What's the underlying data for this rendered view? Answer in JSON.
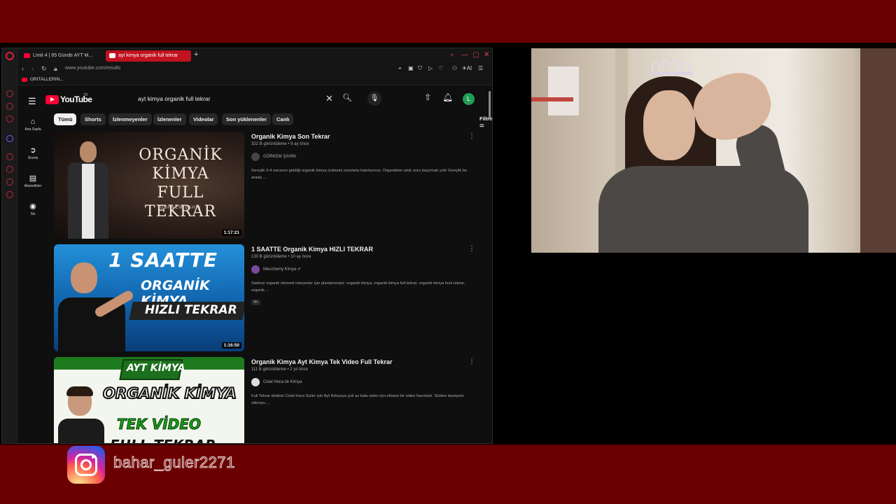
{
  "browser": {
    "tabs": [
      {
        "label": "Limit 4 | 65 Günde AYT M...",
        "active": false
      },
      {
        "label": "ayt kimya organik full tekrar",
        "active": true
      }
    ],
    "url": "www.youtube.com/results",
    "bookmark": "ORITALLERIN...",
    "ai_label": "AI"
  },
  "youtube": {
    "logo_text": "YouTube",
    "logo_country": "TR",
    "search_query": "ayt kimya organik full tekrar",
    "avatar_letter": "L",
    "guide": [
      {
        "label": "Ana Sayfa",
        "icon": "home-icon"
      },
      {
        "label": "Shorts",
        "icon": "shorts-icon"
      },
      {
        "label": "Abonelikler",
        "icon": "subscriptions-icon"
      },
      {
        "label": "Siz",
        "icon": "you-icon"
      }
    ],
    "chips": [
      "Tümü",
      "Shorts",
      "İzlenmeyenler",
      "İzlenenler",
      "Videolar",
      "Son yüklenenler",
      "Canlı"
    ],
    "filters_label": "Filtreler",
    "results": [
      {
        "title": "Organik Kimya Son Tekrar",
        "stats": "322 B görüntüleme • 9 ay önce",
        "channel": "GÖRKEM ŞAHİN",
        "description": "Gençlik 3-4 sorunun geldiği organik kimya ünitesini sorularla hatırlıyoruz. Organikten artık soru kaçırmak yok! Gençlik bu arada ...",
        "duration": "1:17:21",
        "thumb_text": [
          "ORGANİK",
          "KİMYA",
          "FULL TEKRAR"
        ],
        "thumb_sub": "GÖRKEM ŞAHİN"
      },
      {
        "title": "1 SAATTE Organik Kimya HIZLI TEKRAR",
        "stats": "130 B görüntüleme • 10 ay önce",
        "channel": "Meschemy Kimya",
        "description": "Sadece organik izlemek isteyenler için planlanmıştır: organik kimya, organik kimya full tekrar, organik kimya hızlı tekrar, organik ...",
        "badge": "4K",
        "duration": "1:16:50",
        "thumb_text": [
          "1 SAATTE",
          "ORGANİK KİMYA",
          "HIZLI TEKRAR"
        ]
      },
      {
        "title": "Organik Kimya Ayt Kimya Tek Video Full Tekrar",
        "stats": "111 B görüntüleme • 2 yıl önce",
        "channel": "Celal Hoca ile Kimya",
        "description": "Full Tekrar dediniz Celal hoca Sizler için Ayt Kimyaya çok az kala sizler için efsane bir video hazırladı. Sizlere tavsiyem videoyu ...",
        "thumb_text": [
          "AYT KİMYA",
          "ORGANİK KİMYA",
          "TEK VİDEO",
          "FULL TEKRAR"
        ]
      }
    ]
  },
  "overlay": {
    "instagram_handle": "bahar_guler2271"
  }
}
